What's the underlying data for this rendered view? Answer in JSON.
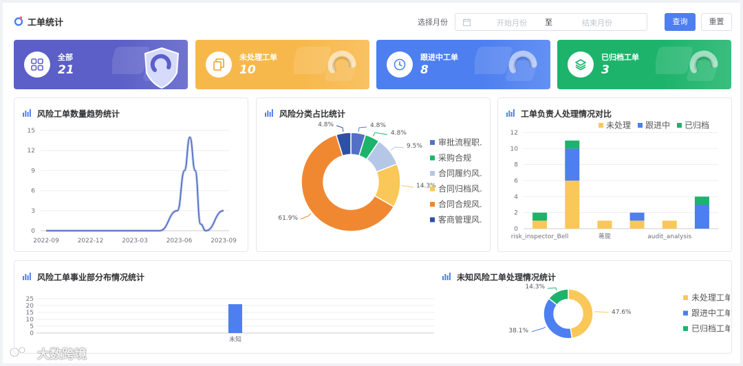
{
  "header": {
    "title": "工单统计",
    "month_label": "选择月份",
    "start_placeholder": "开始月份",
    "range_separator": "至",
    "end_placeholder": "结束月份",
    "query_label": "查询",
    "reset_label": "重置"
  },
  "stats": [
    {
      "label": "全部",
      "value": "21",
      "color": "#5b5fc7",
      "icon": "grid-icon"
    },
    {
      "label": "未处理工单",
      "value": "10",
      "color": "#f7b84b",
      "icon": "copy-icon"
    },
    {
      "label": "跟进中工单",
      "value": "8",
      "color": "#4d7ff0",
      "icon": "clock-icon"
    },
    {
      "label": "已归档工单",
      "value": "3",
      "color": "#1db36b",
      "icon": "layers-icon"
    }
  ],
  "cards": {
    "trend": "风险工单数量趋势统计",
    "category": "风险分类占比统计",
    "owner": "工单负责人处理情况对比",
    "department": "风险工单事业部分布情况统计",
    "unknown": "未知风险工单处理情况统计"
  },
  "watermark": "大数跨境",
  "chart_data": [
    {
      "type": "line",
      "x": [
        "2022-09",
        "2022-12",
        "2023-03",
        "2023-06",
        "2023-09"
      ],
      "yticks": [
        "0",
        "3",
        "6",
        "9",
        "12",
        "15"
      ],
      "ylim": [
        0,
        15
      ],
      "points": [
        [
          0,
          0
        ],
        [
          0.64,
          0
        ],
        [
          0.74,
          3
        ],
        [
          0.78,
          9
        ],
        [
          0.81,
          14
        ],
        [
          0.84,
          9
        ],
        [
          0.87,
          1
        ],
        [
          0.9,
          0
        ],
        [
          1.0,
          3
        ]
      ],
      "color": "#5470c6"
    },
    {
      "type": "pie",
      "slices": [
        {
          "name": "审批流程职.",
          "value": 4.8,
          "label": "4.8%",
          "color": "#5470c6"
        },
        {
          "name": "采购合规",
          "value": 4.8,
          "label": "4.8%",
          "color": "#1db36b"
        },
        {
          "name": "合同履约风.",
          "value": 9.5,
          "label": "9.5%",
          "color": "#b5c7e6"
        },
        {
          "name": "合同归档风.",
          "value": 14.3,
          "label": "14.3%",
          "color": "#fac858"
        },
        {
          "name": "合同合规风.",
          "value": 61.9,
          "label": "61.9%",
          "color": "#f08832"
        },
        {
          "name": "客商管理风.",
          "value": 4.8,
          "label": "4.8%",
          "color": "#2e4fa8"
        }
      ]
    },
    {
      "type": "bar",
      "stacked": true,
      "legend": [
        "未处理",
        "跟进中",
        "已归档"
      ],
      "colors": [
        "#fac858",
        "#4d7ff0",
        "#1db36b"
      ],
      "xlabels": [
        "risk_inspector_Bell",
        "",
        "蒋旎",
        "",
        "audit_analysis",
        ""
      ],
      "yticks": [
        "0",
        "2",
        "4",
        "6",
        "8",
        "10",
        "12"
      ],
      "ylim": [
        0,
        12
      ],
      "series": [
        {
          "name": "未处理",
          "values": [
            1,
            6,
            1,
            1,
            1,
            0
          ]
        },
        {
          "name": "跟进中",
          "values": [
            0,
            4,
            0,
            1,
            0,
            3
          ]
        },
        {
          "name": "已归档",
          "values": [
            1,
            1,
            0,
            0,
            0,
            1
          ]
        }
      ]
    },
    {
      "type": "bar",
      "categories": [
        "未知"
      ],
      "values": [
        21
      ],
      "yticks": [
        "0",
        "5",
        "10",
        "15",
        "20",
        "25"
      ],
      "ylim": [
        0,
        25
      ],
      "color": "#4d7ff0"
    },
    {
      "type": "pie",
      "slices": [
        {
          "name": "未处理工单",
          "value": 47.6,
          "label": "47.6%",
          "color": "#fac858"
        },
        {
          "name": "跟进中工单",
          "value": 38.1,
          "label": "38.1%",
          "color": "#4d7ff0"
        },
        {
          "name": "已归档工单",
          "value": 14.3,
          "label": "14.3%",
          "color": "#1db36b"
        }
      ]
    }
  ]
}
